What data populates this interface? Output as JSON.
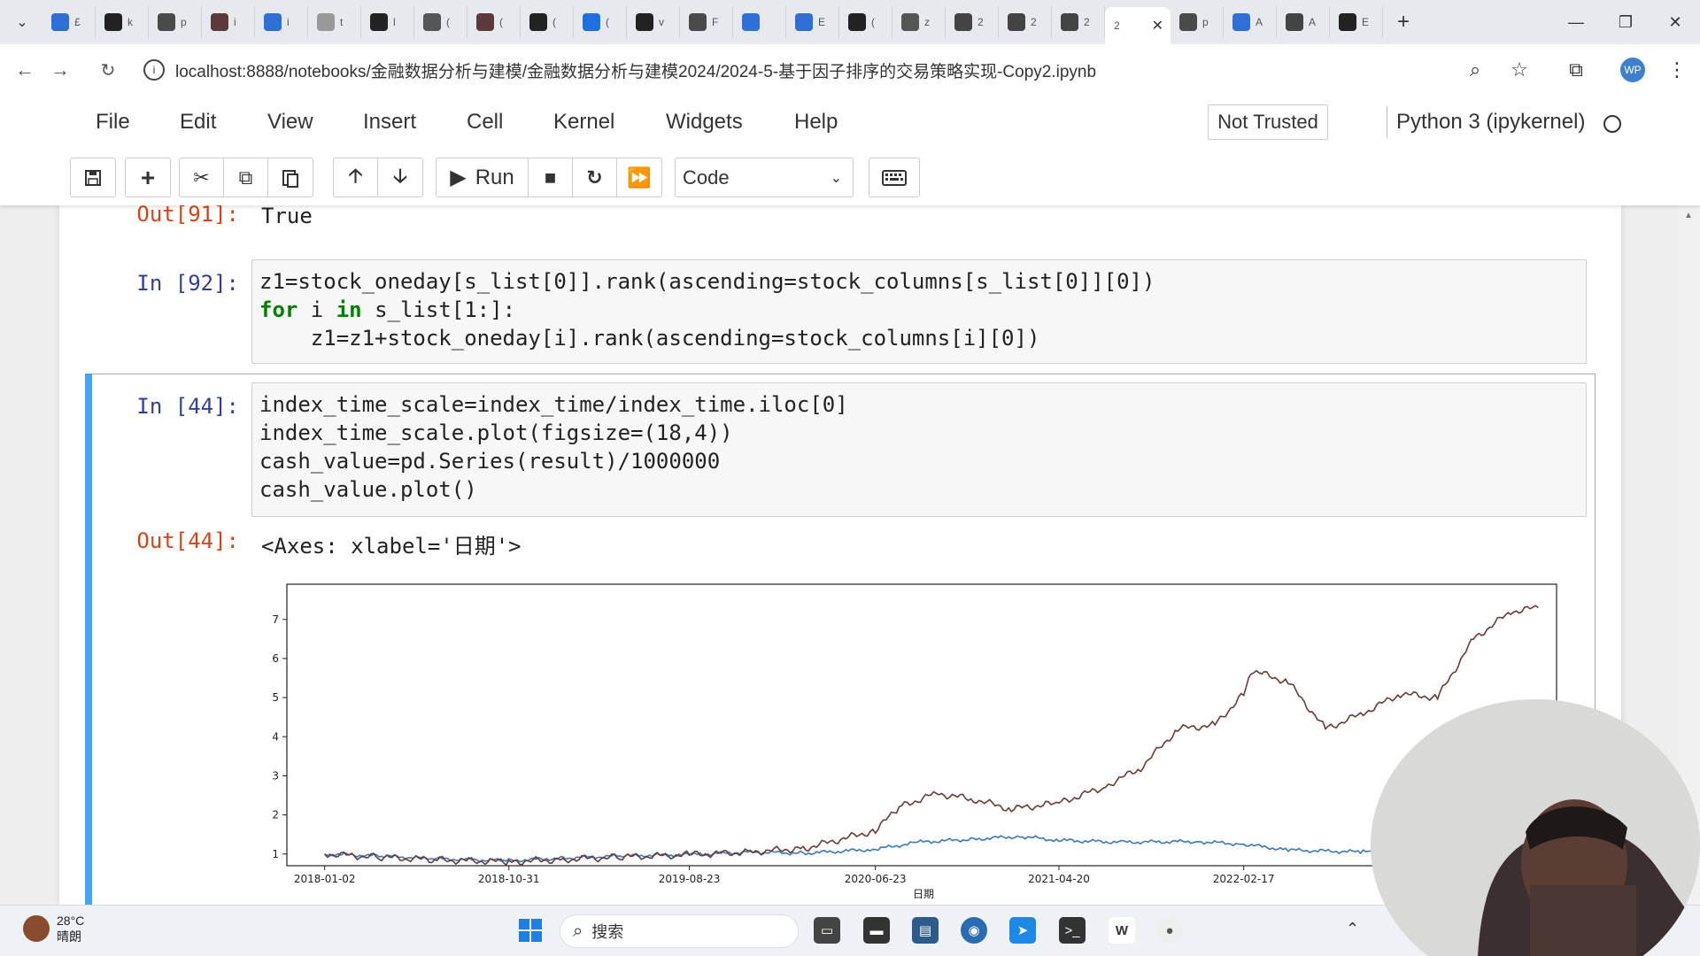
{
  "browser": {
    "tabs": [
      {
        "label": "£",
        "icon": "bot-icon",
        "color": "#2f6fd6"
      },
      {
        "label": "k",
        "icon": "github-icon",
        "color": "#222222"
      },
      {
        "label": "p",
        "icon": "c-icon",
        "color": "#4a4a4a"
      },
      {
        "label": "i",
        "icon": "mail-icon",
        "color": "#5a3a3a"
      },
      {
        "label": "i",
        "icon": "vscode-icon",
        "color": "#2f6fd6"
      },
      {
        "label": "t",
        "icon": "cursor-icon",
        "color": "#999999"
      },
      {
        "label": "l",
        "icon": "github-icon",
        "color": "#222222"
      },
      {
        "label": "(",
        "icon": "cube-icon",
        "color": "#555555"
      },
      {
        "label": "(",
        "icon": "mail-icon",
        "color": "#5a3a3a"
      },
      {
        "label": "(",
        "icon": "github-icon",
        "color": "#222222"
      },
      {
        "label": "(",
        "icon": "zhihu-icon",
        "color": "#1e6fe0"
      },
      {
        "label": "v",
        "icon": "github-icon",
        "color": "#222222"
      },
      {
        "label": "F",
        "icon": "c-icon",
        "color": "#4a4a4a"
      },
      {
        "label": "",
        "icon": "cloud-icon",
        "color": "#2f6fd6"
      },
      {
        "label": "E",
        "icon": "cloud-icon",
        "color": "#2f6fd6"
      },
      {
        "label": "(",
        "icon": "github-icon",
        "color": "#222222"
      },
      {
        "label": "z",
        "icon": "loading-icon",
        "color": "#555555"
      },
      {
        "label": "2",
        "icon": "book-icon",
        "color": "#444444"
      },
      {
        "label": "2",
        "icon": "book-icon",
        "color": "#444444"
      },
      {
        "label": "2",
        "icon": "book-icon",
        "color": "#444444"
      }
    ],
    "active_tab": {
      "label": "2"
    },
    "tabs_after": [
      {
        "label": "p",
        "icon": "c-icon",
        "color": "#4a4a4a"
      },
      {
        "label": "A",
        "icon": "paw-icon",
        "color": "#2f6fd6"
      },
      {
        "label": "A",
        "icon": "brush-icon",
        "color": "#444444"
      },
      {
        "label": "E",
        "icon": "link-icon",
        "color": "#222222"
      }
    ],
    "new_tab": "+",
    "url": "localhost:8888/notebooks/金融数据分析与建模/金融数据分析与建模2024/2024-5-基于因子排序的交易策略实现-Copy2.ipynb",
    "profile_initials": "WP"
  },
  "jupyter": {
    "menu": [
      "File",
      "Edit",
      "View",
      "Insert",
      "Cell",
      "Kernel",
      "Widgets",
      "Help"
    ],
    "trust": "Not Trusted",
    "kernel": "Python 3 (ipykernel)",
    "run_label": "Run",
    "cell_type": "Code"
  },
  "cells": {
    "out91": {
      "prompt": "Out[91]:",
      "text": "True"
    },
    "in92": {
      "prompt": "In  [92]:",
      "lines": [
        "z1=stock_oneday[s_list[0]].rank(ascending=stock_columns[s_list[0]][0])",
        "for i in s_list[1:]:",
        "    z1=z1+stock_oneday[i].rank(ascending=stock_columns[i][0])"
      ]
    },
    "in44": {
      "prompt": "In  [44]:",
      "lines": [
        "index_time_scale=index_time/index_time.iloc[0]",
        "index_time_scale.plot(figsize=(18,4))",
        "cash_value=pd.Series(result)/1000000",
        "cash_value.plot()"
      ]
    },
    "out44": {
      "prompt": "Out[44]:",
      "text": "<Axes: xlabel='日期'>"
    }
  },
  "chart_data": {
    "type": "line",
    "xlabel": "日期",
    "ylabel": "",
    "ylim": [
      0.7,
      7.9
    ],
    "xlim": [
      "2017-11-01",
      "2023-07-15"
    ],
    "yticks": [
      1,
      2,
      3,
      4,
      5,
      6,
      7
    ],
    "xticks": [
      "2018-01-02",
      "2018-10-31",
      "2019-08-23",
      "2020-06-23",
      "2021-04-20",
      "2022-02-17"
    ],
    "grid": false,
    "series": [
      {
        "color": "#3a78b8",
        "points": [
          [
            "2018-01-02",
            1.0
          ],
          [
            "2018-04-01",
            0.95
          ],
          [
            "2018-07-01",
            0.88
          ],
          [
            "2018-10-31",
            0.83
          ],
          [
            "2019-02-01",
            0.9
          ],
          [
            "2019-05-01",
            0.95
          ],
          [
            "2019-08-23",
            0.98
          ],
          [
            "2019-12-01",
            1.05
          ],
          [
            "2020-03-01",
            1.02
          ],
          [
            "2020-06-23",
            1.12
          ],
          [
            "2020-09-01",
            1.3
          ],
          [
            "2020-12-01",
            1.38
          ],
          [
            "2021-02-15",
            1.45
          ],
          [
            "2021-04-20",
            1.35
          ],
          [
            "2021-08-01",
            1.3
          ],
          [
            "2021-12-01",
            1.32
          ],
          [
            "2022-02-17",
            1.25
          ],
          [
            "2022-05-01",
            1.1
          ],
          [
            "2022-09-01",
            1.05
          ],
          [
            "2022-12-01",
            1.1
          ],
          [
            "2023-03-01",
            1.05
          ],
          [
            "2023-06-01",
            1.02
          ]
        ]
      },
      {
        "color": "#6b3b35",
        "points": [
          [
            "2018-01-02",
            1.0
          ],
          [
            "2018-04-01",
            0.92
          ],
          [
            "2018-07-01",
            0.85
          ],
          [
            "2018-10-31",
            0.8
          ],
          [
            "2019-02-01",
            0.86
          ],
          [
            "2019-05-01",
            0.92
          ],
          [
            "2019-08-23",
            0.98
          ],
          [
            "2019-12-01",
            1.05
          ],
          [
            "2020-03-01",
            1.15
          ],
          [
            "2020-06-23",
            1.6
          ],
          [
            "2020-08-01",
            2.2
          ],
          [
            "2020-10-01",
            2.55
          ],
          [
            "2020-12-01",
            2.4
          ],
          [
            "2021-02-01",
            2.15
          ],
          [
            "2021-04-20",
            2.3
          ],
          [
            "2021-07-01",
            2.7
          ],
          [
            "2021-09-01",
            3.2
          ],
          [
            "2021-11-01",
            4.2
          ],
          [
            "2022-01-01",
            4.3
          ],
          [
            "2022-02-17",
            5.1
          ],
          [
            "2022-03-01",
            5.7
          ],
          [
            "2022-05-01",
            5.4
          ],
          [
            "2022-07-01",
            4.2
          ],
          [
            "2022-09-01",
            4.6
          ],
          [
            "2022-11-01",
            5.1
          ],
          [
            "2023-01-01",
            5.0
          ],
          [
            "2023-03-01",
            6.5
          ],
          [
            "2023-05-01",
            7.2
          ],
          [
            "2023-06-15",
            7.3
          ]
        ]
      }
    ]
  },
  "taskbar": {
    "weather_temp": "28°C",
    "weather_desc": "晴朗",
    "search_placeholder": "搜索"
  }
}
